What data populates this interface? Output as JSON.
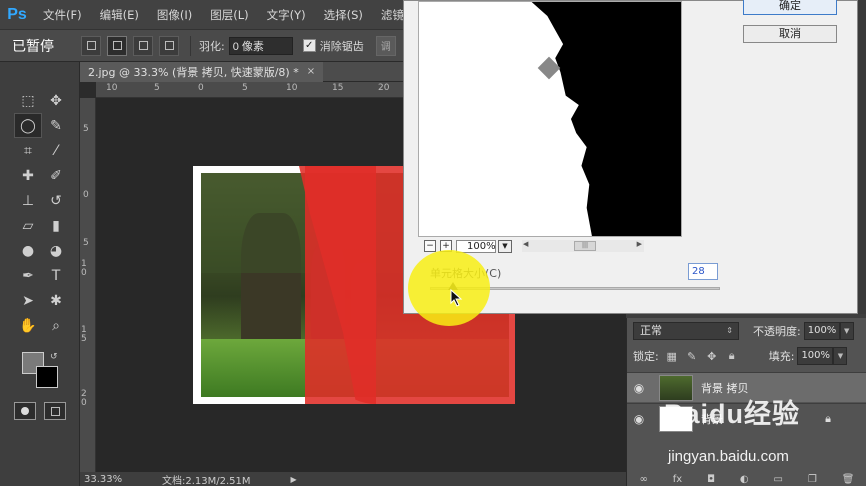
{
  "app": {
    "logo": "Ps",
    "menus": [
      "文件(F)",
      "编辑(E)",
      "图像(I)",
      "图层(L)",
      "文字(Y)",
      "选择(S)",
      "滤镜"
    ]
  },
  "options_bar": {
    "paused_text": "已暂停",
    "feather_label": "羽化:",
    "feather_value": "0 像素",
    "antialias_label": "消除锯齿",
    "antialias_checked": true,
    "refine_label": "调"
  },
  "document": {
    "tab_title": "2.jpg @ 33.3% (背景 拷贝, 快速蒙版/8) *",
    "close_glyph": "×",
    "ruler_top_labels": [
      "10",
      "5",
      "0",
      "5",
      "10",
      "15",
      "20"
    ],
    "ruler_left_labels": [
      "5",
      "0",
      "5",
      "1 0",
      "1 5",
      "2 0"
    ],
    "zoom_status": "33.33%",
    "doc_status": "文档:2.13M/2.51M",
    "overlay_color": "#e02e28"
  },
  "dialog": {
    "ok_label": "确定",
    "cancel_label": "取消",
    "zoom_minus": "−",
    "zoom_plus": "+",
    "zoom_value": "100%",
    "cell_size_label": "单元格大小(C)",
    "cell_size_value": "28",
    "slider_percent": 8
  },
  "layers": {
    "blend_mode": "正常",
    "opacity_label": "不透明度:",
    "opacity_value": "100%",
    "lock_label": "锁定:",
    "fill_label": "填充:",
    "fill_value": "100%",
    "items": [
      {
        "name": "背景 拷贝",
        "selected": true,
        "locked": false
      },
      {
        "name": "背景",
        "selected": false,
        "locked": true
      }
    ]
  },
  "watermark": {
    "logo": "Baidu经验",
    "url": "jingyan.baidu.com"
  },
  "colors": {
    "highlight": "#f8ee14",
    "ps_blue": "#31a8ff"
  }
}
